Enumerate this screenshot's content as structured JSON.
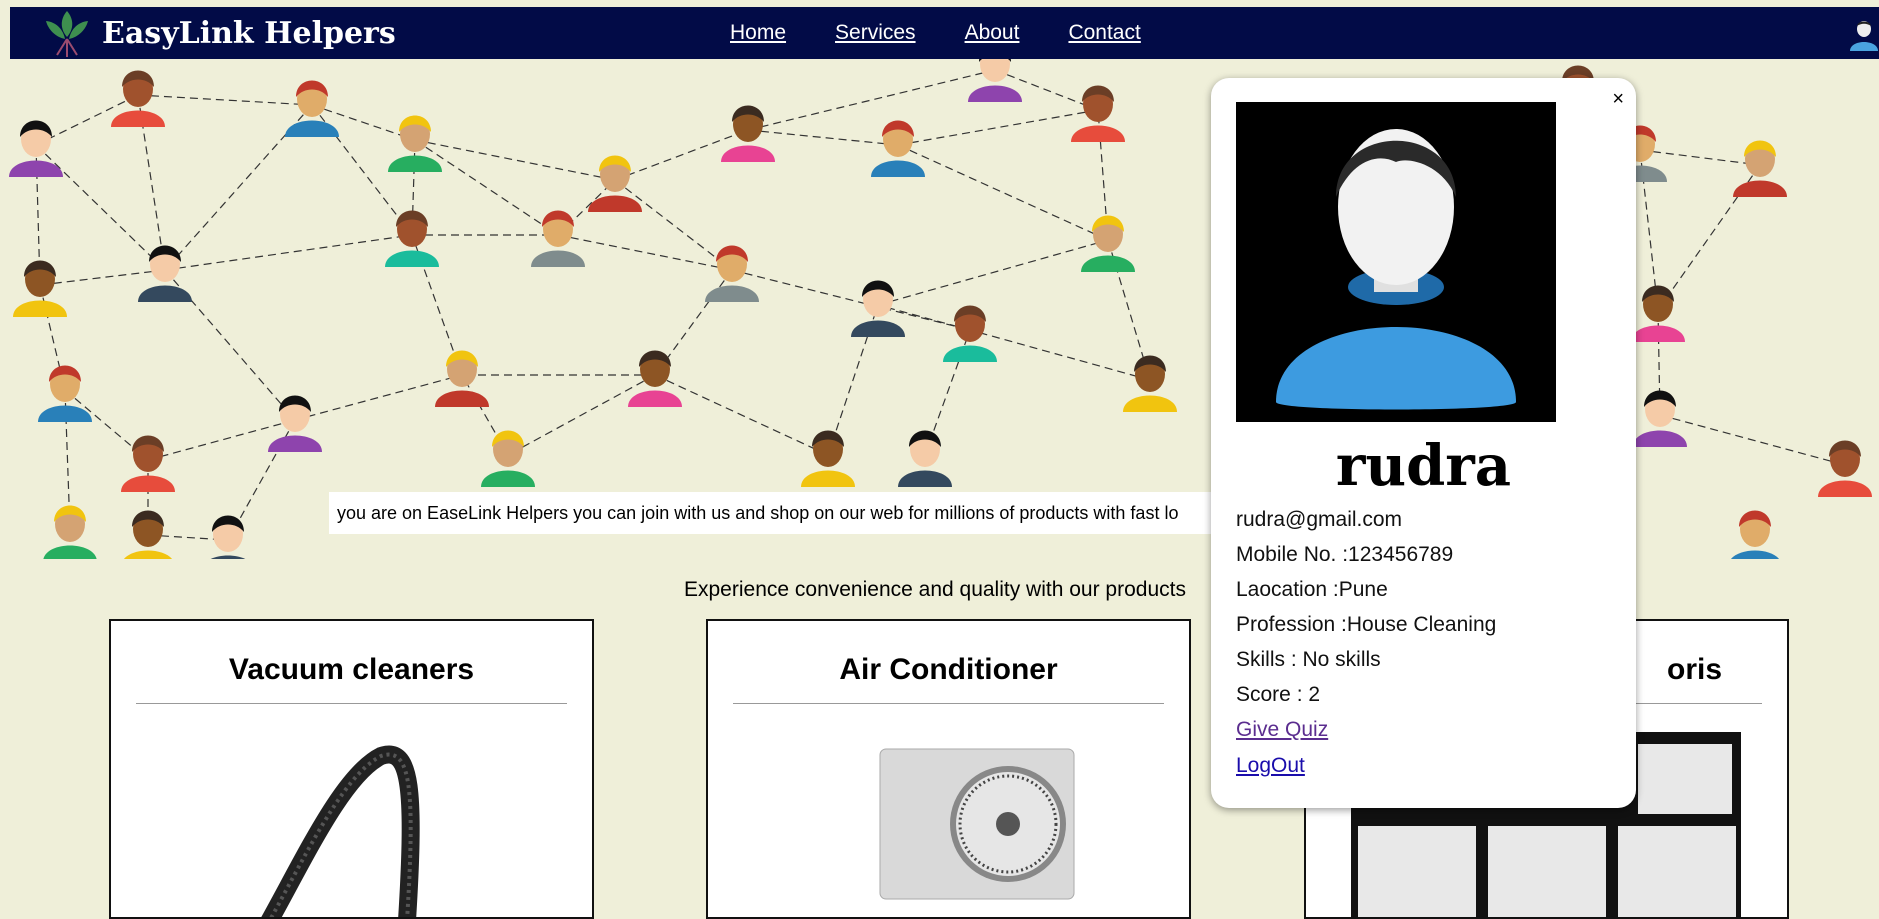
{
  "brand": {
    "name": "EasyLink Helpers"
  },
  "nav": {
    "items": [
      {
        "label": "Home"
      },
      {
        "label": "Services"
      },
      {
        "label": "About"
      },
      {
        "label": "Contact"
      }
    ]
  },
  "hero": {
    "marquee_text": "you are on EaseLink Helpers you can join with us and shop on our web for millions of products with fast lo"
  },
  "tagline": "Experience convenience and quality with our products",
  "products": [
    {
      "title": "Vacuum cleaners"
    },
    {
      "title": "Air Conditioner"
    },
    {
      "title": "oris"
    }
  ],
  "profile": {
    "close_label": "×",
    "name": "rudra",
    "email": "rudra@gmail.com",
    "mobile": "Mobile No. :123456789",
    "location": "Laocation :Pune",
    "profession": "Profession :House Cleaning",
    "skills": "Skills : No skills",
    "score": "Score : 2",
    "quiz_link": "Give Quiz",
    "logout_link": "LogOut"
  },
  "colors": {
    "navbar": "#020b47",
    "background": "#efefd9",
    "link_visited": "#5b2d8f",
    "link": "#1a0dab"
  }
}
